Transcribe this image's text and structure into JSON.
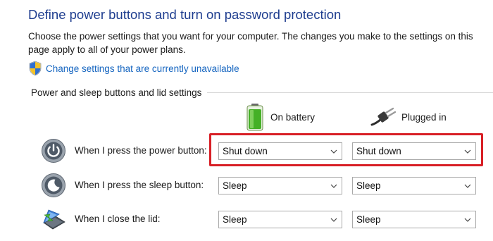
{
  "header": {
    "title": "Define power buttons and turn on password protection",
    "description": "Choose the power settings that you want for your computer. The changes you make to the settings on this page apply to all of your power plans.",
    "change_settings_link": "Change settings that are currently unavailable"
  },
  "section": {
    "label": "Power and sleep buttons and lid settings"
  },
  "columns": {
    "on_battery": "On battery",
    "plugged_in": "Plugged in"
  },
  "rows": [
    {
      "label": "When I press the power button:",
      "icon": "power-button-icon",
      "on_battery": "Shut down",
      "plugged_in": "Shut down"
    },
    {
      "label": "When I press the sleep button:",
      "icon": "sleep-button-icon",
      "on_battery": "Sleep",
      "plugged_in": "Sleep"
    },
    {
      "label": "When I close the lid:",
      "icon": "laptop-lid-icon",
      "on_battery": "Sleep",
      "plugged_in": "Sleep"
    }
  ],
  "colors": {
    "title": "#1e3d8f",
    "link": "#1565c0",
    "highlight": "#d81f26"
  }
}
